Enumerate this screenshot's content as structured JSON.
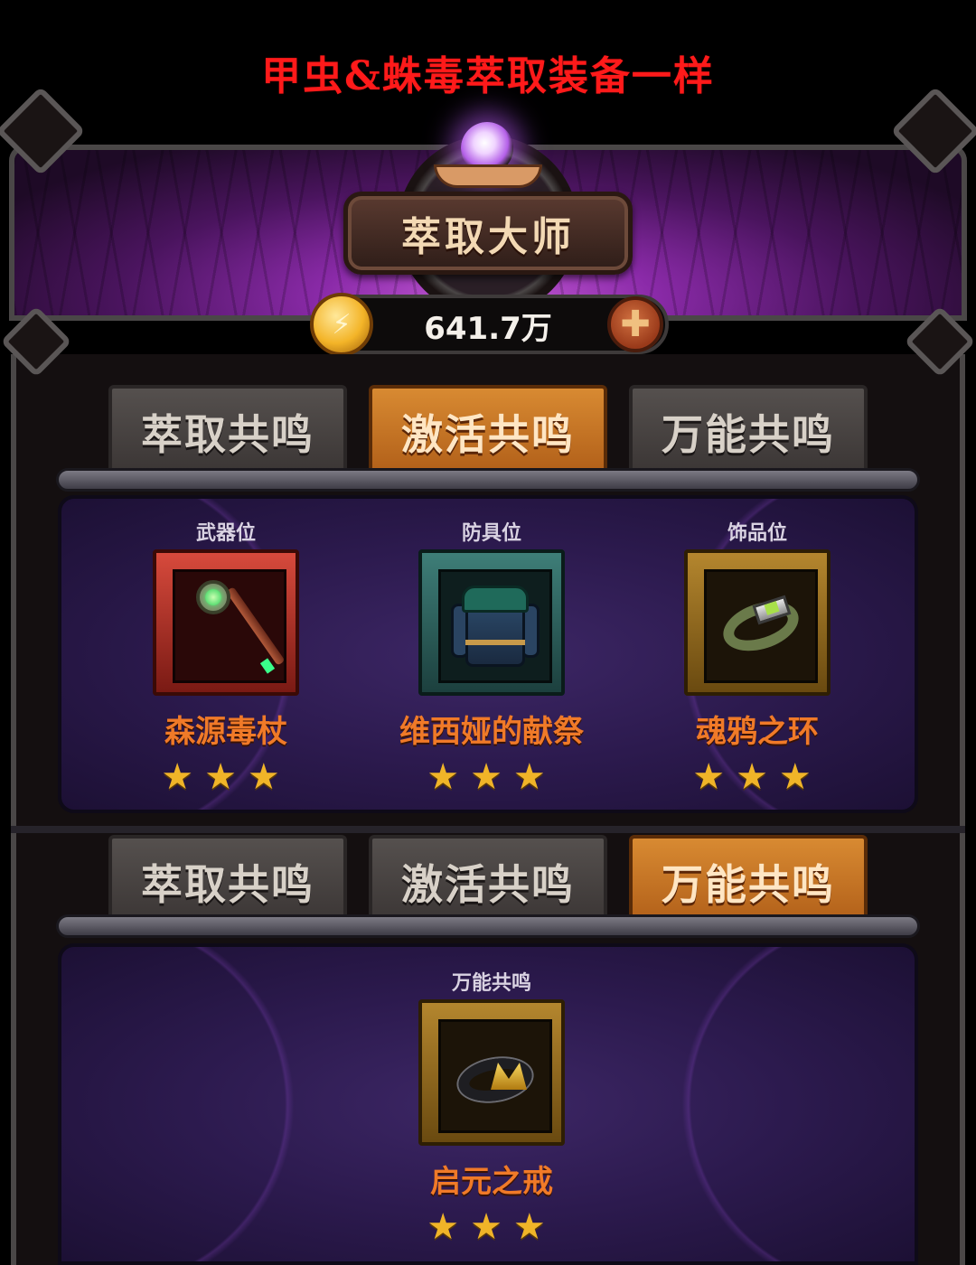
{
  "caption": {
    "text": "甲虫&蛛毒萃取装备一样",
    "color": "#ff1a1a"
  },
  "header": {
    "title": "萃取大师",
    "currency_amount": "641.7万",
    "coin_icon": "⚡",
    "plus_icon": "✚"
  },
  "section1": {
    "tabs": [
      {
        "label": "萃取共鸣",
        "active": false
      },
      {
        "label": "激活共鸣",
        "active": true
      },
      {
        "label": "万能共鸣",
        "active": false
      }
    ],
    "slots": [
      {
        "slot_label": "武器位",
        "item_name": "森源毒杖",
        "stars": "★★★",
        "frame": "red",
        "icon": "staff-icon"
      },
      {
        "slot_label": "防具位",
        "item_name": "维西娅的献祭",
        "stars": "★★★",
        "frame": "teal",
        "icon": "armor-icon"
      },
      {
        "slot_label": "饰品位",
        "item_name": "魂鸦之环",
        "stars": "★★★",
        "frame": "gold",
        "icon": "ring-icon"
      }
    ]
  },
  "section2": {
    "tabs": [
      {
        "label": "萃取共鸣",
        "active": false
      },
      {
        "label": "激活共鸣",
        "active": false
      },
      {
        "label": "万能共鸣",
        "active": true
      }
    ],
    "slots": [
      {
        "slot_label": "万能共鸣",
        "item_name": "启元之戒",
        "stars": "★★★",
        "frame": "gold",
        "icon": "ring-icon"
      }
    ]
  },
  "colors": {
    "accent_orange": "#d88a32",
    "item_name": "#f07a28",
    "star": "#f0b428",
    "panel_purple": "#2c1a4e"
  }
}
